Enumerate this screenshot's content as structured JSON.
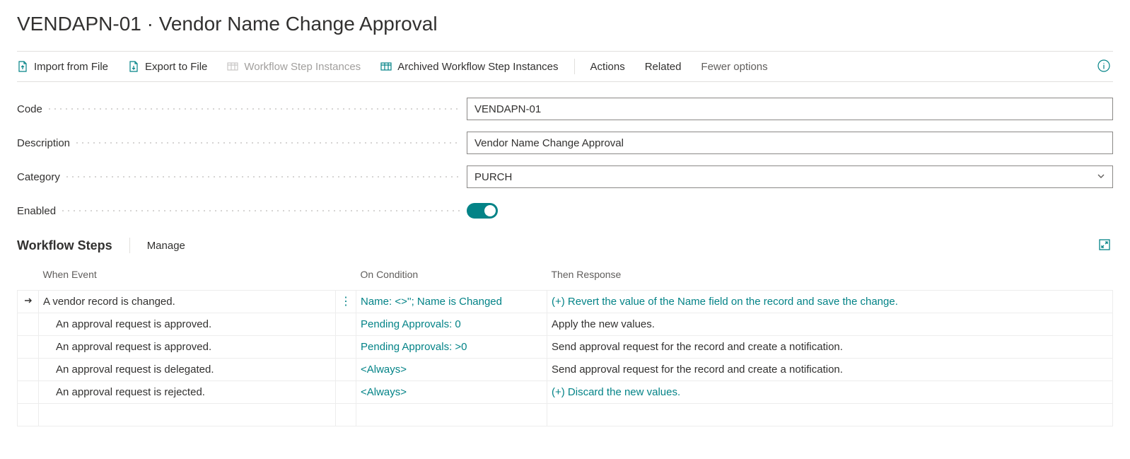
{
  "title": "VENDAPN-01 · Vendor Name Change Approval",
  "actions": {
    "import": "Import from File",
    "export": "Export to File",
    "stepInstances": "Workflow Step Instances",
    "archived": "Archived Workflow Step Instances",
    "actionsMenu": "Actions",
    "related": "Related",
    "fewer": "Fewer options"
  },
  "form": {
    "codeLabel": "Code",
    "codeValue": "VENDAPN-01",
    "descLabel": "Description",
    "descValue": "Vendor Name Change Approval",
    "catLabel": "Category",
    "catValue": "PURCH",
    "enabledLabel": "Enabled"
  },
  "steps": {
    "title": "Workflow Steps",
    "manage": "Manage",
    "headers": {
      "event": "When Event",
      "condition": "On Condition",
      "response": "Then Response"
    },
    "rows": [
      {
        "selected": true,
        "indent": false,
        "event": "A vendor record is changed.",
        "condition": "Name: <>''; Name is Changed",
        "conditionLink": true,
        "response": "(+) Revert the value of the Name field on the record and save the change.",
        "responseLink": true
      },
      {
        "selected": false,
        "indent": true,
        "event": "An approval request is approved.",
        "condition": "Pending Approvals: 0",
        "conditionLink": true,
        "response": "Apply the new values.",
        "responseLink": false
      },
      {
        "selected": false,
        "indent": true,
        "event": "An approval request is approved.",
        "condition": "Pending Approvals: >0",
        "conditionLink": true,
        "response": "Send approval request for the record and create a notification.",
        "responseLink": false
      },
      {
        "selected": false,
        "indent": true,
        "event": "An approval request is delegated.",
        "condition": "<Always>",
        "conditionLink": true,
        "response": "Send approval request for the record and create a notification.",
        "responseLink": false
      },
      {
        "selected": false,
        "indent": true,
        "event": "An approval request is rejected.",
        "condition": "<Always>",
        "conditionLink": true,
        "response": "(+) Discard the new values.",
        "responseLink": true
      }
    ]
  }
}
